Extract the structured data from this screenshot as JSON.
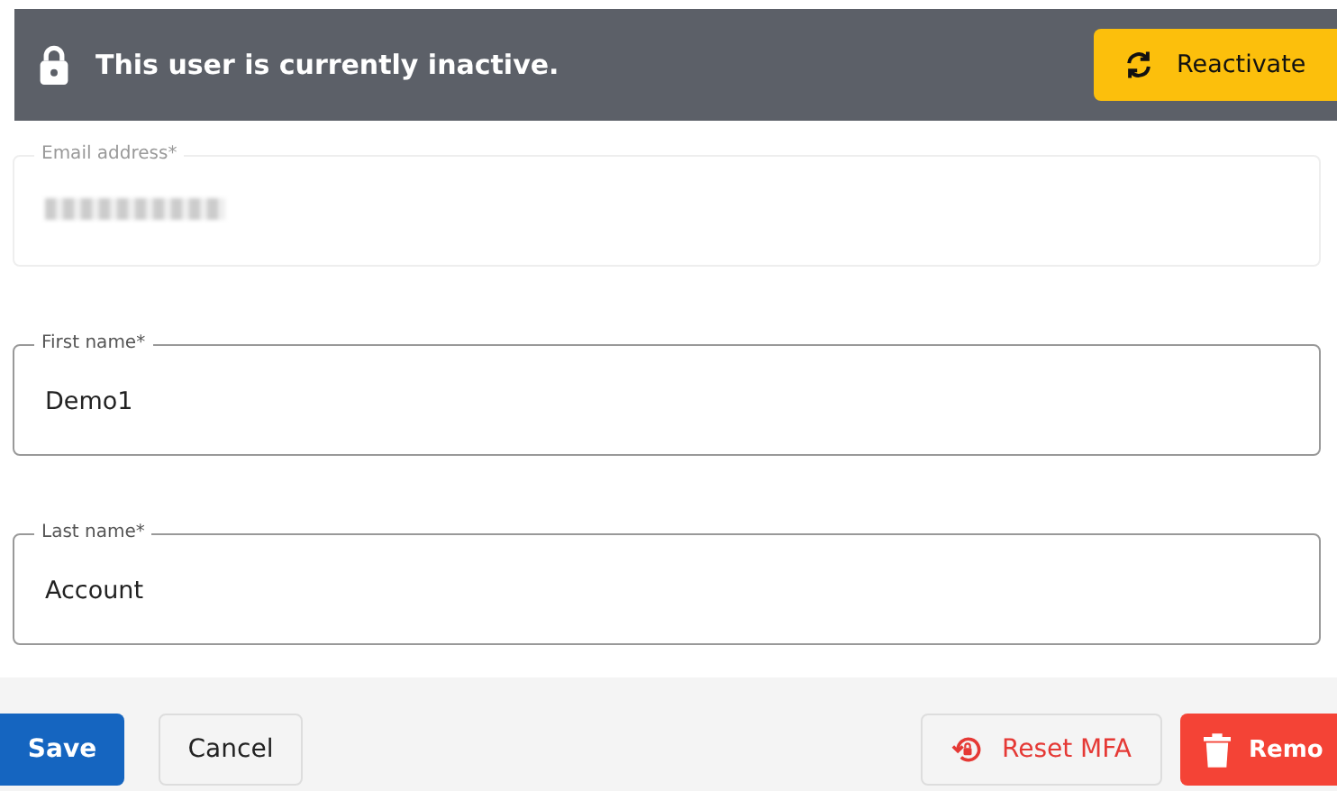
{
  "banner": {
    "message": "This user is currently inactive.",
    "action": "Reactivate"
  },
  "fields": [
    {
      "label": "Email address*",
      "disabled": true
    },
    {
      "label": "First name*",
      "value": "Demo1",
      "disabled": false
    },
    {
      "label": "Last name*",
      "value": "Account",
      "disabled": false
    }
  ],
  "footer": {
    "save": "Save",
    "cancel": "Cancel",
    "reset_mfa": "Reset MFA",
    "remove": "Remo"
  }
}
